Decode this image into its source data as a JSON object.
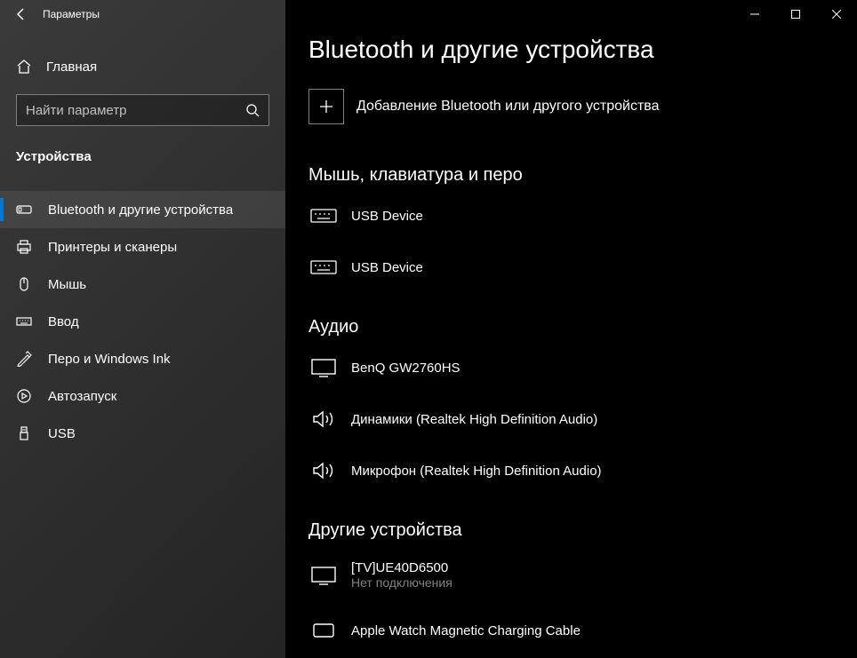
{
  "titlebar": {
    "title": "Параметры"
  },
  "home": {
    "label": "Главная"
  },
  "search": {
    "placeholder": "Найти параметр"
  },
  "category": {
    "title": "Устройства"
  },
  "nav": [
    {
      "label": "Bluetooth и другие устройства",
      "icon": "bluetooth",
      "active": true
    },
    {
      "label": "Принтеры и сканеры",
      "icon": "printer",
      "active": false
    },
    {
      "label": "Мышь",
      "icon": "mouse",
      "active": false
    },
    {
      "label": "Ввод",
      "icon": "keyboard",
      "active": false
    },
    {
      "label": "Перо и Windows Ink",
      "icon": "pen",
      "active": false
    },
    {
      "label": "Автозапуск",
      "icon": "autoplay",
      "active": false
    },
    {
      "label": "USB",
      "icon": "usb",
      "active": false
    }
  ],
  "page": {
    "title": "Bluetooth и другие устройства",
    "add_label": "Добавление Bluetooth или другого устройства"
  },
  "sections": {
    "input": {
      "title": "Мышь, клавиатура и перо",
      "devices": [
        {
          "name": "USB Device",
          "icon": "keyboard"
        },
        {
          "name": "USB Device",
          "icon": "keyboard"
        }
      ]
    },
    "audio": {
      "title": "Аудио",
      "devices": [
        {
          "name": "BenQ GW2760HS",
          "icon": "monitor"
        },
        {
          "name": "Динамики (Realtek High Definition Audio)",
          "icon": "speaker"
        },
        {
          "name": "Микрофон (Realtek High Definition Audio)",
          "icon": "speaker"
        }
      ]
    },
    "other": {
      "title": "Другие устройства",
      "devices": [
        {
          "name": "[TV]UE40D6500",
          "status": "Нет подключения",
          "icon": "monitor"
        },
        {
          "name": "Apple Watch Magnetic Charging Cable",
          "icon": "device"
        }
      ]
    }
  }
}
